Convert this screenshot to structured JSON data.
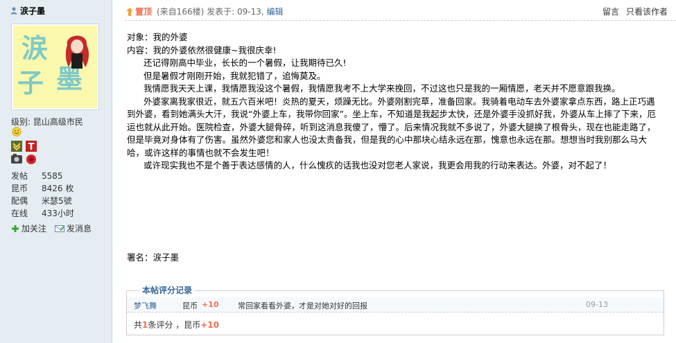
{
  "author": {
    "name": "涙子墨",
    "avatar_chars": [
      "涙",
      "子",
      "墨"
    ],
    "level": "级别: 昆山高级市民",
    "stats": [
      {
        "label": "发帖",
        "value": "5585"
      },
      {
        "label": "昆币",
        "value": "8426 枚"
      },
      {
        "label": "配偶",
        "value": "米瑟5號"
      },
      {
        "label": "在线",
        "value": "433小时"
      }
    ],
    "actions": {
      "follow": "加关注",
      "message": "发消息"
    }
  },
  "post": {
    "pin_label": "置顶",
    "from_floor": "(来自166楼)",
    "posted_at": "发表于: 09-13",
    "edit": "编辑",
    "reply": "留言",
    "only_author": "只看该作者",
    "lines": [
      "对象：我的外婆",
      "内容：我的外婆依然很健康~我很庆幸!",
      "还记得刚高中毕业，长长的一个暑假，让我期待已久!",
      "但是暑假才刚刚开始，我就犯错了，追悔莫及。",
      "我情愿我天天上课，我情愿我没这个暑假，我情愿我考不上大学来挽回，不过这也只是我的一厢情愿，老天并不愿意跟我换。",
      "外婆家离我家很近，就五六百米吧！炎热的夏天，烦躁无比。外婆刚割完草，准备回家。我骑着电动车去外婆家拿点东西，路上正巧遇到外婆，看到她满头大汗，我说“外婆上车，我带你回家”。坐上车，不知道是我起步太快，还是外婆手没抓好我，外婆从车上摔了下来，厄运也就从此开始。医院检查，外婆大腿骨碎，听到这消息我傻了，懵了。后来情况我就不多说了，外婆大腿换了根骨头，现在也能走路了，但是毕竟对身体有了伤害。虽然外婆您和家人也没太责备我，但是我的心中那块心结永远在那，愧意也永远在那。想想当时我别那么马大哈，或许这样的事情也就不会发生吧！",
      "或许现实我也不是个善于表达感情的人，什么愧疚的话我也没对您老人家说，我更会用我的行动来表达。外婆，对不起了！"
    ],
    "signature": "署名：涙子墨"
  },
  "rating": {
    "title": "本帖评分记录",
    "entry": {
      "user": "梦飞舞",
      "kind": "昆币",
      "score": "+10",
      "reason": "常回家看看外婆，才是对她对好的回报",
      "date": "09-13"
    },
    "summary_prefix": "共",
    "summary_count": "1",
    "summary_mid": "条评分 ，昆币",
    "summary_score": "+10"
  },
  "icons": {
    "pin": "pin-arrow-icon",
    "user": "user-icon",
    "smiley": "smiley-icon",
    "follow": "plus-icon",
    "message": "envelope-icon"
  },
  "colors": {
    "accent": "#f26c4f",
    "link": "#336699",
    "sidebar": "#e5edf2",
    "avatar_bg": "#faf8ad"
  }
}
